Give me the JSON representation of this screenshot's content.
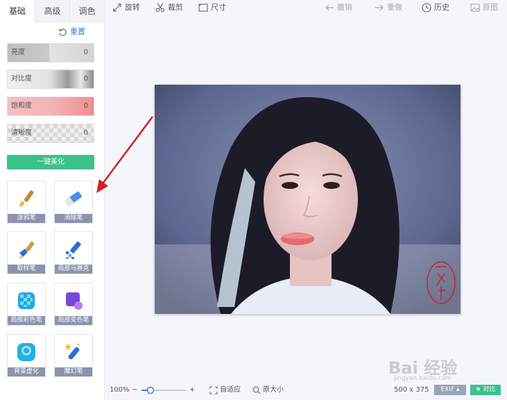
{
  "sidebar": {
    "tabs": [
      {
        "label": "基础"
      },
      {
        "label": "高级"
      },
      {
        "label": "调色"
      }
    ],
    "reset_label": "重置",
    "sliders": [
      {
        "label": "亮度",
        "value": "0"
      },
      {
        "label": "对比度",
        "value": "0"
      },
      {
        "label": "饱和度",
        "value": "0"
      },
      {
        "label": "清晰度",
        "value": "0"
      }
    ],
    "beautify_label": "一键美化",
    "tools": [
      {
        "label": "涂鸦笔",
        "icon": "paintbrush-icon"
      },
      {
        "label": "消除笔",
        "icon": "eraser-icon"
      },
      {
        "label": "取样笔",
        "icon": "sample-brush-icon"
      },
      {
        "label": "局部马赛克",
        "icon": "mosaic-pen-icon"
      },
      {
        "label": "局部彩色笔",
        "icon": "color-pen-icon"
      },
      {
        "label": "局部变色笔",
        "icon": "recolor-pen-icon"
      },
      {
        "label": "背景虚化",
        "icon": "blur-icon"
      },
      {
        "label": "魔幻笔",
        "icon": "magic-pen-icon"
      }
    ]
  },
  "toolbar": {
    "rotate": "旋转",
    "crop": "裁剪",
    "size": "尺寸",
    "undo": "撤销",
    "redo": "重做",
    "history": "历史",
    "original": "原图"
  },
  "bottombar": {
    "zoom": "100%",
    "zoom_level": 0.2,
    "fit": "自适应",
    "actual_size": "原大小",
    "dimensions": "500 x 375",
    "exif": "EXIF",
    "compare": "对比"
  },
  "watermark": {
    "text": "Bai 经验",
    "sub": "jingyan.baidu.com"
  },
  "colors": {
    "accent": "#3cc18a",
    "tool_label": "#8c93ad",
    "link": "#3b7fd6",
    "arrow": "#d0201e"
  }
}
